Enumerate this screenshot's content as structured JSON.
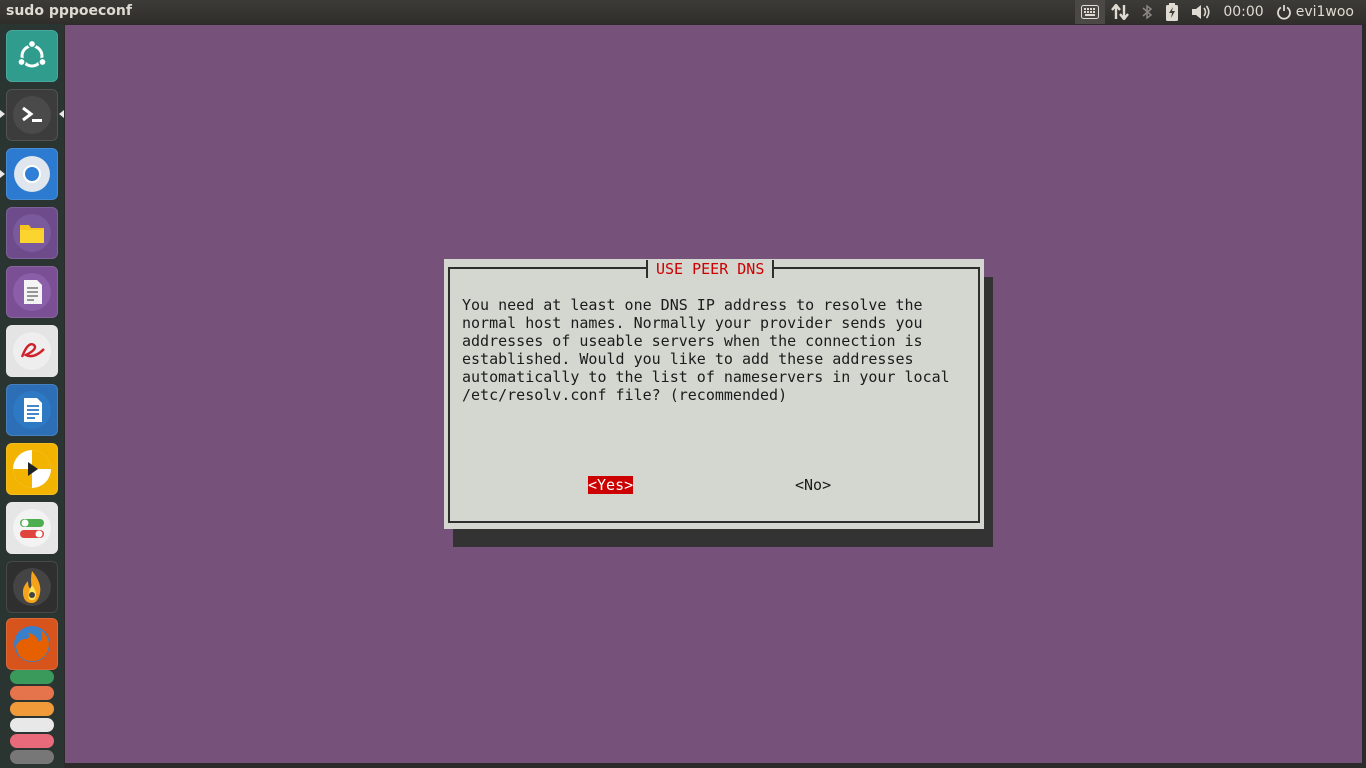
{
  "window_title": "sudo pppoeconf",
  "panel": {
    "time": "00:00",
    "user": "evi1woo",
    "indicators": [
      "keyboard-icon",
      "network-arrows-icon",
      "bluetooth-icon",
      "battery-icon",
      "volume-icon",
      "power-icon"
    ]
  },
  "launcher": {
    "items": [
      {
        "name": "dash-home",
        "icon": "ubuntu-logo-icon",
        "color": "#2f9c8e"
      },
      {
        "name": "terminal",
        "icon": "terminal-icon",
        "color": "#3c3c3c",
        "running": true,
        "focused": true
      },
      {
        "name": "chromium",
        "icon": "chromium-icon",
        "color": "#2d7bd1",
        "running": true
      },
      {
        "name": "files",
        "icon": "folder-icon",
        "color": "#6e4c8c"
      },
      {
        "name": "text-editor",
        "icon": "document-icon",
        "color": "#7a4f93"
      },
      {
        "name": "evince",
        "icon": "pdf-viewer-icon",
        "color": "#e4e4e4"
      },
      {
        "name": "writer",
        "icon": "writer-icon",
        "color": "#2d6fb6"
      },
      {
        "name": "media-player",
        "icon": "play-icon",
        "color": "#f2b400"
      },
      {
        "name": "settings-toggles",
        "icon": "toggle-icon",
        "color": "#e6e6e6"
      },
      {
        "name": "disc-burner",
        "icon": "flame-icon",
        "color": "#2f2f2f"
      },
      {
        "name": "firefox",
        "icon": "firefox-icon",
        "color": "#d7541c"
      },
      {
        "name": "stacked-apps",
        "icon": "app-stack-icon",
        "color": "#3a9a5b"
      }
    ]
  },
  "dialog": {
    "title": "USE PEER DNS",
    "message": "You need at least one DNS IP address to resolve the\nnormal host names. Normally your provider sends you\naddresses of useable servers when the connection is\nestablished. Would you like to add these addresses\nautomatically to the list of nameservers in your local\n/etc/resolv.conf file? (recommended)",
    "yes_label": "<Yes>",
    "no_label": "<No>"
  },
  "colors": {
    "desktop_bg": "#76527a",
    "dialog_bg": "#d3d7cf",
    "accent_red": "#cc0000",
    "shadow": "#333333"
  }
}
